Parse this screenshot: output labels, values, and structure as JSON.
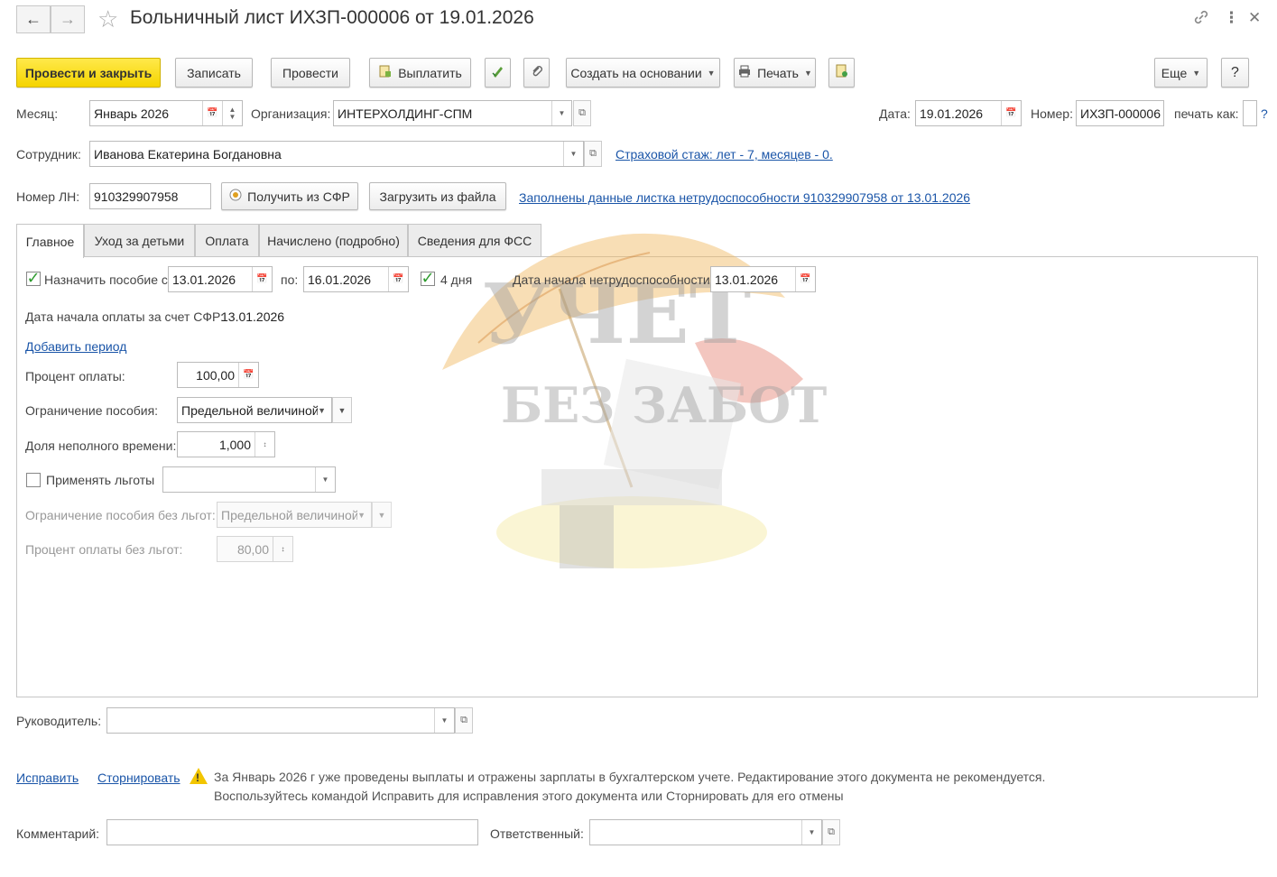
{
  "header": {
    "title": "Больничный лист ИХЗП-000006 от 19.01.2026",
    "back_icon": "arrow-left-icon",
    "forward_icon": "arrow-right-icon",
    "link_icon": "link-icon",
    "more_icon": "more-vertical-icon",
    "close_icon": "close-icon"
  },
  "toolbar": {
    "post_close": "Провести и закрыть",
    "save": "Записать",
    "post": "Провести",
    "pay": "Выплатить",
    "create_based": "Создать на основании",
    "print": "Печать",
    "more": "Еще",
    "help": "?"
  },
  "form": {
    "month_label": "Месяц:",
    "month_value": "Январь 2026",
    "org_label": "Организация:",
    "org_value": "ИНТЕРХОЛДИНГ-СПМ",
    "date_label": "Дата:",
    "date_value": "19.01.2026",
    "number_label": "Номер:",
    "number_value": "ИХЗП-000006",
    "print_as_label": "печать как:",
    "print_as_help": "?",
    "employee_label": "Сотрудник:",
    "employee_value": "Иванова Екатерина Богдановна",
    "insurance_link": "Страховой стаж: лет - 7, месяцев - 0.",
    "ln_label": "Номер ЛН:",
    "ln_value": "910329907958",
    "get_sfr": "Получить из СФР",
    "load_file": "Загрузить из файла",
    "filled_link": "Заполнены данные листка нетрудоспособности 910329907958 от 13.01.2026"
  },
  "tabs": [
    {
      "label": "Главное"
    },
    {
      "label": "Уход за детьми"
    },
    {
      "label": "Оплата"
    },
    {
      "label": "Начислено (подробно)"
    },
    {
      "label": "Сведения для ФСС"
    }
  ],
  "payment": {
    "assign_label": "Назначить пособие с:",
    "assign_checked": true,
    "from_value": "13.01.2026",
    "to_label": "по:",
    "to_value": "16.01.2026",
    "days_checked": true,
    "days_label": "4 дня",
    "start_label": "Дата начала нетрудоспособности:",
    "start_value": "13.01.2026",
    "sfr_start_label": "Дата начала оплаты за счет СФР:",
    "sfr_start_value": "13.01.2026",
    "add_period": "Добавить период",
    "percent_label": "Процент оплаты:",
    "percent_value": "100,00",
    "limit_label": "Ограничение пособия:",
    "limit_value": "Предельной величиной",
    "part_label": "Доля неполного времени:",
    "part_value": "1,000",
    "benefits_label": "Применять льготы",
    "benefits_checked": false,
    "benefits_value": "",
    "limit_nob_label": "Ограничение пособия без льгот:",
    "limit_nob_value": "Предельной величиной",
    "percent_nob_label": "Процент оплаты без льгот:",
    "percent_nob_value": "80,00"
  },
  "watermark": {
    "line1": "УЧЕТ",
    "line2": "БЕЗ ЗАБОТ"
  },
  "footer": {
    "manager_label": "Руководитель:",
    "manager_value": "",
    "fix_link": "Исправить",
    "storno_link": "Сторнировать",
    "warning_line1": "За Январь 2026 г уже проведены выплаты и отражены зарплаты в бухгалтерском учете. Редактирование этого документа не рекомендуется.",
    "warning_line2": "Воспользуйтесь командой Исправить для исправления этого документа или Сторнировать для его отмены",
    "comment_label": "Комментарий:",
    "comment_value": "",
    "responsible_label": "Ответственный:",
    "responsible_value": ""
  },
  "colors": {
    "primary_button": "#f5d400",
    "link": "#1a55a8",
    "check": "#2e9b2e",
    "warning": "#f2c500"
  }
}
